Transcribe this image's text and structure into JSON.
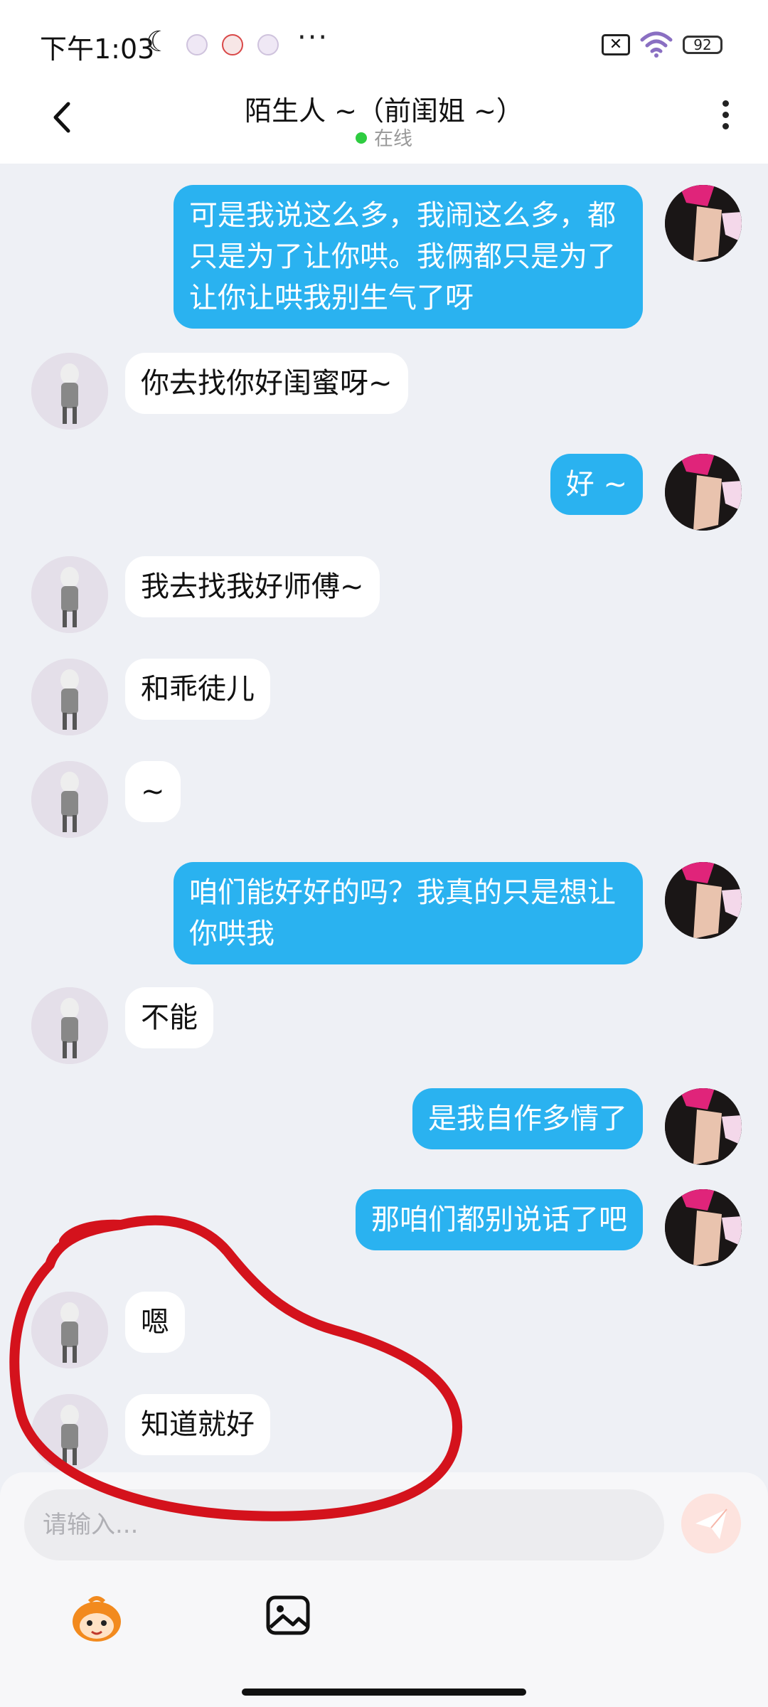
{
  "status_bar": {
    "time": "下午1:03",
    "battery": "92"
  },
  "header": {
    "title": "陌生人 ~（前闺姐 ~）",
    "status": "在线"
  },
  "messages": [
    {
      "side": "out",
      "text": "可是我说这么多，我闹这么多，都只是为了让你哄。我俩都只是为了让你让哄我别生气了呀"
    },
    {
      "side": "in",
      "text": "你去找你好闺蜜呀~"
    },
    {
      "side": "out",
      "text": "好 ~"
    },
    {
      "side": "in",
      "text": "我去找我好师傅~"
    },
    {
      "side": "in",
      "text": "和乖徒儿"
    },
    {
      "side": "in",
      "text": "~"
    },
    {
      "side": "out",
      "text": "咱们能好好的吗？我真的只是想让你哄我"
    },
    {
      "side": "in",
      "text": "不能"
    },
    {
      "side": "out",
      "text": "是我自作多情了"
    },
    {
      "side": "out",
      "text": "那咱们都别说话了吧"
    },
    {
      "side": "in",
      "text": "嗯"
    },
    {
      "side": "in",
      "text": "知道就好"
    }
  ],
  "composer": {
    "placeholder": "请输入..."
  },
  "colors": {
    "outgoing_bubble": "#2ab2f0",
    "incoming_bubble": "#ffffff",
    "background": "#eef0f5",
    "annotation": "#d4121c",
    "online_dot": "#2ecc40"
  },
  "icons": [
    "back-arrow-icon",
    "more-vertical-icon",
    "send-icon",
    "mascot-icon",
    "image-icon"
  ]
}
